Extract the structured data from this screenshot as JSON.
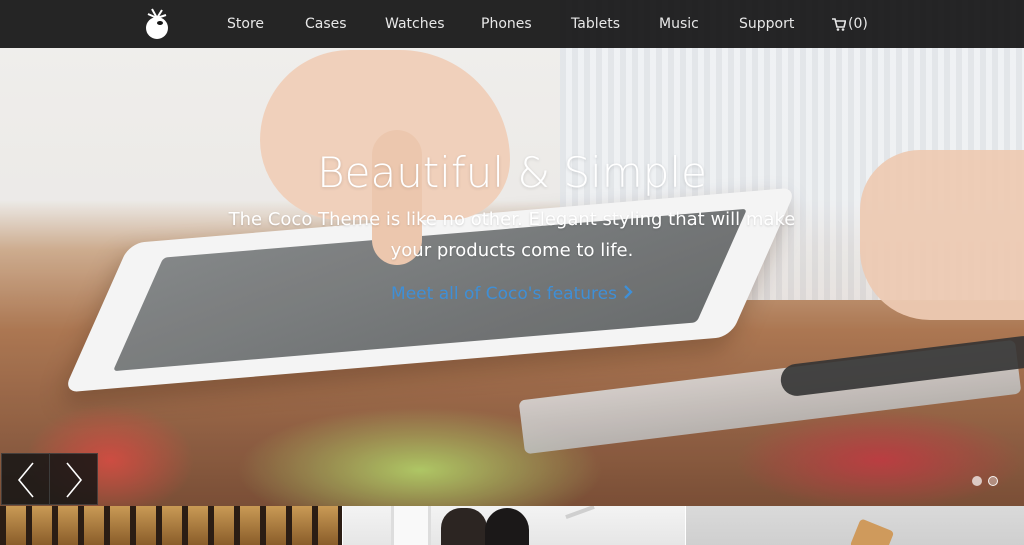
{
  "header": {
    "nav": [
      {
        "id": "store",
        "label": "Store"
      },
      {
        "id": "cases",
        "label": "Cases"
      },
      {
        "id": "watches",
        "label": "Watches"
      },
      {
        "id": "phones",
        "label": "Phones"
      },
      {
        "id": "tablets",
        "label": "Tablets"
      },
      {
        "id": "music",
        "label": "Music"
      },
      {
        "id": "support",
        "label": "Support"
      }
    ],
    "cart": {
      "icon": "cart-icon",
      "count": "(0)"
    },
    "logo_icon": "coconut-logo-icon"
  },
  "hero": {
    "title": "Beautiful & Simple",
    "subtitle": "The Coco Theme is like no other. Elegant styling that will make your products come to life.",
    "link": {
      "label": "Meet all of Coco's features",
      "icon": "chevron-right-icon"
    },
    "prev_icon": "arrow-left-icon",
    "next_icon": "arrow-right-icon",
    "slides": [
      {
        "active": false
      },
      {
        "active": true
      }
    ]
  },
  "thumbnails": [
    {
      "id": "forest",
      "icon": "forest-image"
    },
    {
      "id": "office",
      "icon": "people-at-desk-image"
    },
    {
      "id": "case",
      "icon": "phone-case-image"
    }
  ],
  "colors": {
    "topbar": "#141414",
    "link": "#3f8fd6",
    "text_light": "#ffffff"
  }
}
